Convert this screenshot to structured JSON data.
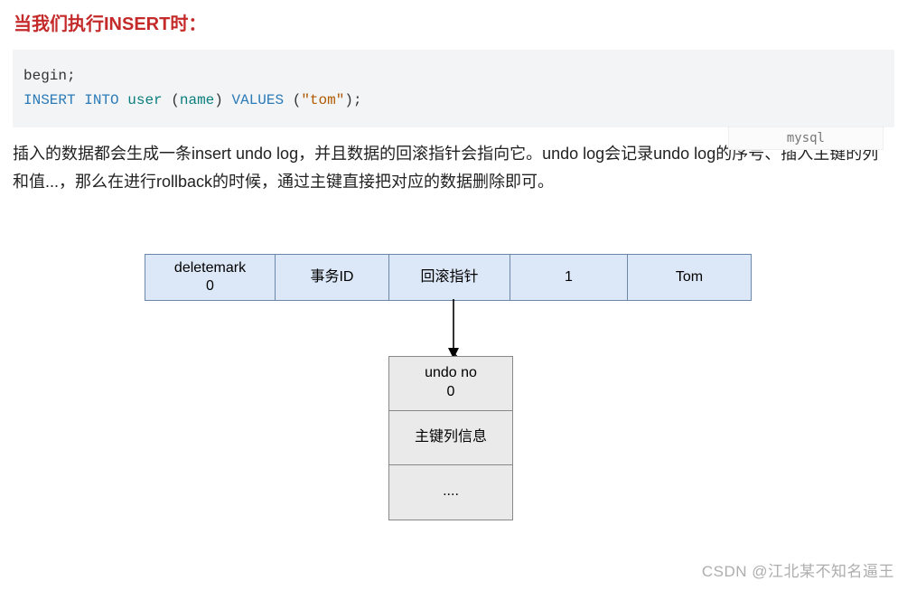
{
  "heading": "当我们执行INSERT时：",
  "code": {
    "line1": "begin;",
    "kw_insert": "INSERT",
    "kw_into": "INTO",
    "ident_user": "user",
    "col_name": "name",
    "kw_values": "VALUES",
    "str_tom": "\"tom\""
  },
  "lang_hint": "mysql",
  "paragraph": "插入的数据都会生成一条insert undo log，并且数据的回滚指针会指向它。undo log会记录undo log的序号、插入主键的列和值...，那么在进行rollback的时候，通过主键直接把对应的数据删除即可。",
  "row": {
    "c0a": "deletemark",
    "c0b": "0",
    "c1": "事务ID",
    "c2": "回滚指针",
    "c3": "1",
    "c4": "Tom"
  },
  "undo": {
    "r0a": "undo no",
    "r0b": "0",
    "r1": "主键列信息",
    "r2": "...."
  },
  "watermark": "CSDN @江北某不知名逼王"
}
